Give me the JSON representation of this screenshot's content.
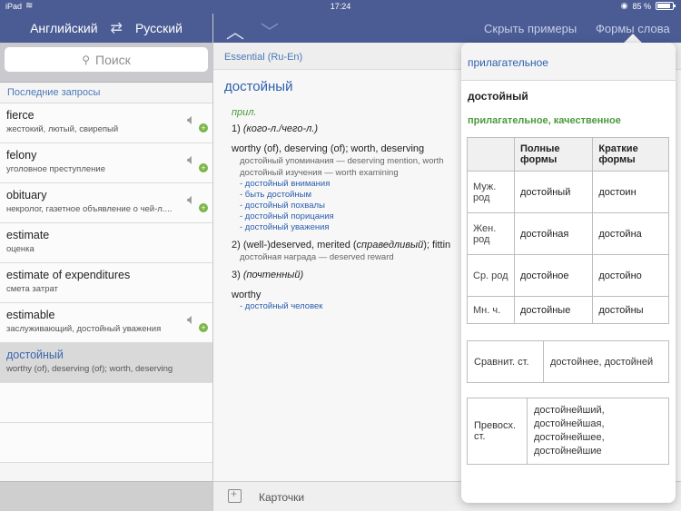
{
  "status": {
    "carrier": "iPad",
    "time": "17:24",
    "battery": "85 %"
  },
  "lang": {
    "from": "Английский",
    "to": "Русский"
  },
  "search": {
    "placeholder": "Поиск"
  },
  "history": {
    "title": "Последние запросы",
    "items": [
      {
        "word": "fierce",
        "translation": "жестокий, лютый, свирепый",
        "sound": true
      },
      {
        "word": "felony",
        "translation": "уголовное преступление",
        "sound": true
      },
      {
        "word": "obituary",
        "translation": "некролог, газетное объявление о чей-л....",
        "sound": true
      },
      {
        "word": "estimate",
        "translation": "оценка",
        "sound": false
      },
      {
        "word": "estimate of expenditures",
        "translation": "смета затрат",
        "sound": false
      },
      {
        "word": "estimable",
        "translation": "заслуживающий, достойный уважения",
        "sound": true
      },
      {
        "word": "достойный",
        "translation": "worthy (of), deserving (of); worth, deserving",
        "sound": false
      }
    ]
  },
  "nav": {
    "hide_examples": "Скрыть примеры",
    "word_forms": "Формы слова"
  },
  "entry": {
    "dictionary": "Essential (Ru-En)",
    "headword": "достойный",
    "pos": "прил.",
    "s1_num": "1) ",
    "s1_gloss": "(кого-л./чего-л.)",
    "s1_trans": "worthy (of), deserving (of); worth, deserving",
    "s1_ex1": "достойный упоминания — deserving mention, worth",
    "s1_ex2": "достойный изучения — worth examining",
    "s1_links": [
      "- достойный внимания",
      "- быть достойным",
      "- достойный похвалы",
      "- достойный порицания",
      "- достойный уважения"
    ],
    "s2_trans_a": "2) (well-)deserved, merited (",
    "s2_trans_i": "справедливый",
    "s2_trans_b": "); fittin",
    "s2_ex": "достойная награда — deserved reward",
    "s3_num": "3) ",
    "s3_gloss": "(почтенный)",
    "s3_trans": "worthy",
    "s3_link": "- достойный человек"
  },
  "bottom": {
    "cards": "Карточки"
  },
  "forms": {
    "title": "прилагательное",
    "word": "достойный",
    "category": "прилагательное, качественное",
    "col_full": "Полные формы",
    "col_short": "Краткие формы",
    "rows": [
      {
        "label": "Муж. род",
        "full": "достойный",
        "short": "достоин"
      },
      {
        "label": "Жен. род",
        "full": "достойная",
        "short": "достойна"
      },
      {
        "label": "Ср. род",
        "full": "достойное",
        "short": "достойно"
      },
      {
        "label": "Мн. ч.",
        "full": "достойные",
        "short": "достойны"
      }
    ],
    "comparative_label": "Сравнит. ст.",
    "comparative": "достойнее, достойней",
    "superlative_label": "Превосх. ст.",
    "superlative": [
      "достойнейший,",
      "достойнейшая,",
      "достойнейшее,",
      "достойнейшие"
    ]
  },
  "colors": {
    "bar": "#4b5c95",
    "link": "#2c5fae",
    "pos": "#4a9a3c"
  }
}
